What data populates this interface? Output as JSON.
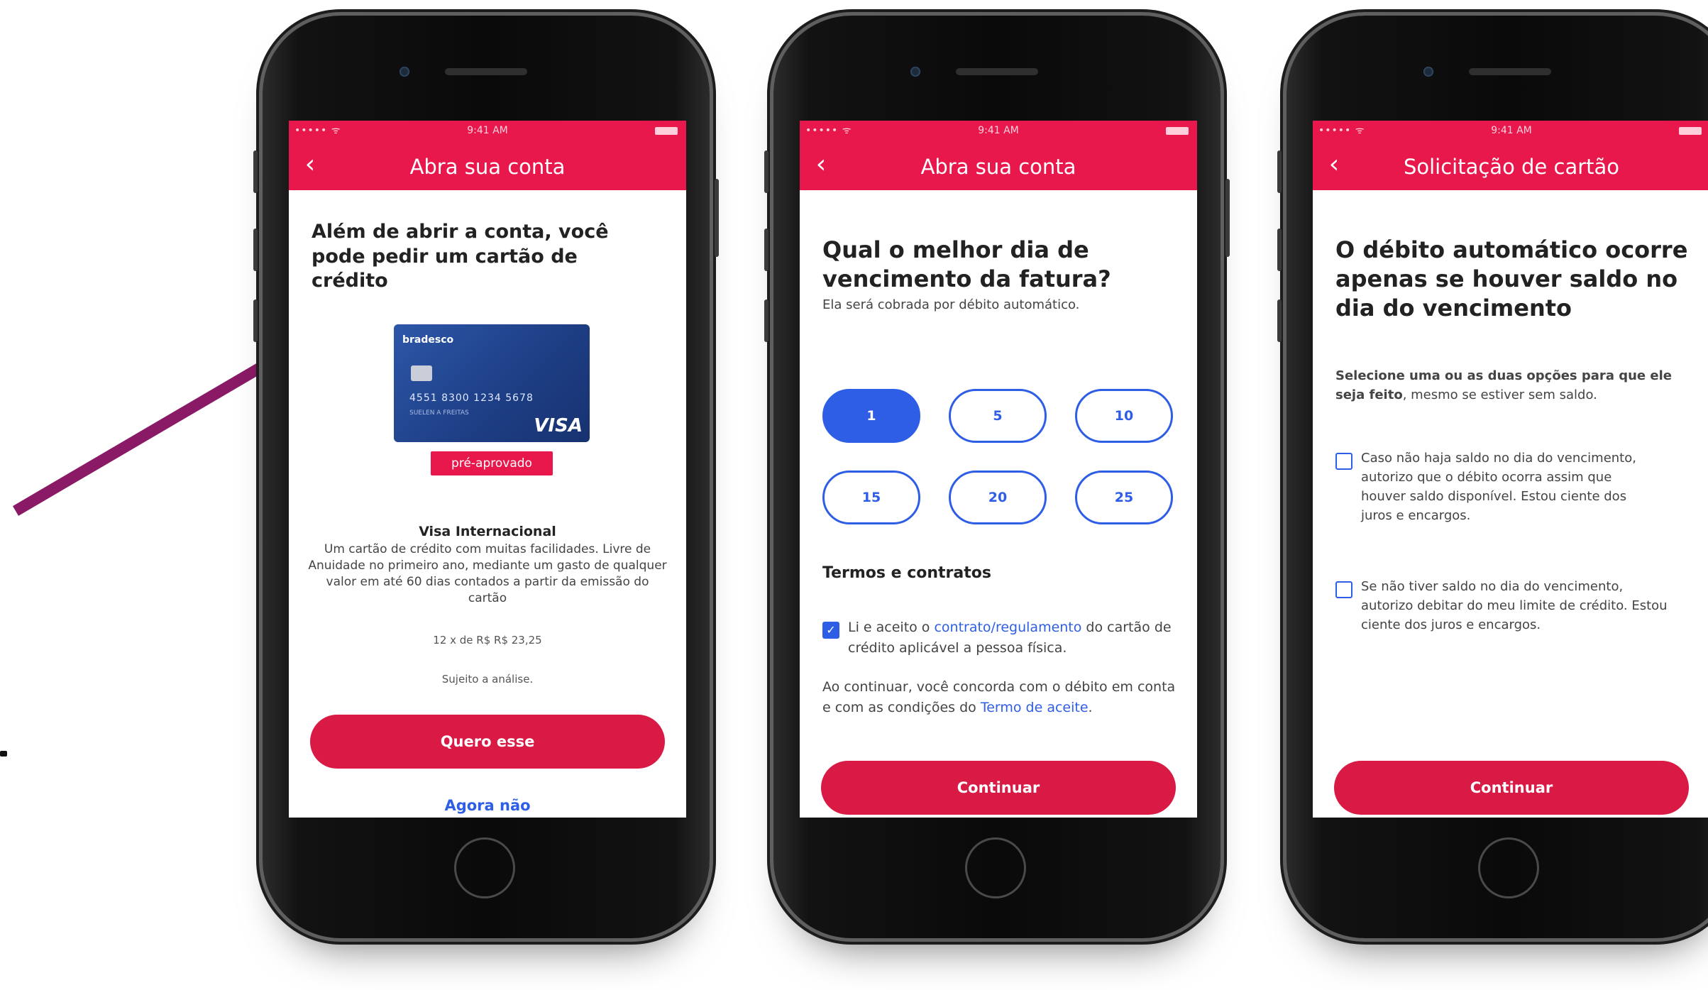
{
  "colors": {
    "brand": "#e8174c",
    "button": "#d81a45",
    "accent": "#2f5ee6",
    "deco_line": "#8a1a66"
  },
  "phones": [
    {
      "status": {
        "signal": "••••• ᯤ",
        "time": "9:41 AM"
      },
      "header": {
        "back_icon": "chevron-left-icon",
        "title": "Abra sua conta"
      },
      "heading": "Além de abrir a conta, você pode pedir um cartão de crédito",
      "card": {
        "brand": "bradesco",
        "number": "4551 8300 1234 5678",
        "holder": "SUELEN A FREITAS",
        "network": "VISA"
      },
      "badge": "pré-aprovado",
      "product_name": "Visa Internacional",
      "product_desc": "Um cartão de crédito com muitas facilidades. Livre de Anuidade no primeiro ano, mediante um gasto de qualquer valor em até 60 dias contados a partir da emissão do cartão",
      "installments": "12 x de R$ R$ 23,25",
      "subject": "Sujeito a análise.",
      "primary_button": "Quero esse",
      "secondary_link": "Agora não"
    },
    {
      "status": {
        "signal": "••••• ᯤ",
        "time": "9:41 AM"
      },
      "header": {
        "back_icon": "chevron-left-icon",
        "title": "Abra sua conta"
      },
      "heading": "Qual o melhor dia de vencimento da fatura?",
      "subheading": "Ela será cobrada por débito automático.",
      "days": [
        "1",
        "5",
        "10",
        "15",
        "20",
        "25"
      ],
      "selected_day": "1",
      "terms_title": "Termos e contratos",
      "terms_check": {
        "checked": true,
        "prefix": "Li e aceito o ",
        "link": "contrato/regulamento",
        "suffix": " do cartão de crédito aplicável a pessoa física."
      },
      "consent": {
        "prefix": "Ao continuar, você concorda com o débito em conta e com as condições do ",
        "link": "Termo de aceite",
        "suffix": "."
      },
      "primary_button": "Continuar"
    },
    {
      "status": {
        "signal": "••••• ᯤ",
        "time": "9:41 AM"
      },
      "header": {
        "back_icon": "chevron-left-icon",
        "title": "Solicitação de cartão"
      },
      "heading": "O débito automático ocorre apenas se houver saldo no dia do vencimento",
      "instruction": {
        "bold": "Selecione uma ou as duas opções para que ele seja feito",
        "rest": ", mesmo se estiver sem saldo."
      },
      "options": [
        "Caso não haja saldo no dia do vencimento, autorizo que o débito ocorra assim que houver saldo disponível. Estou ciente dos juros e encargos.",
        "Se não tiver saldo no dia do vencimento, autorizo debitar do meu limite de crédito. Estou ciente dos juros e encargos."
      ],
      "primary_button": "Continuar"
    }
  ]
}
